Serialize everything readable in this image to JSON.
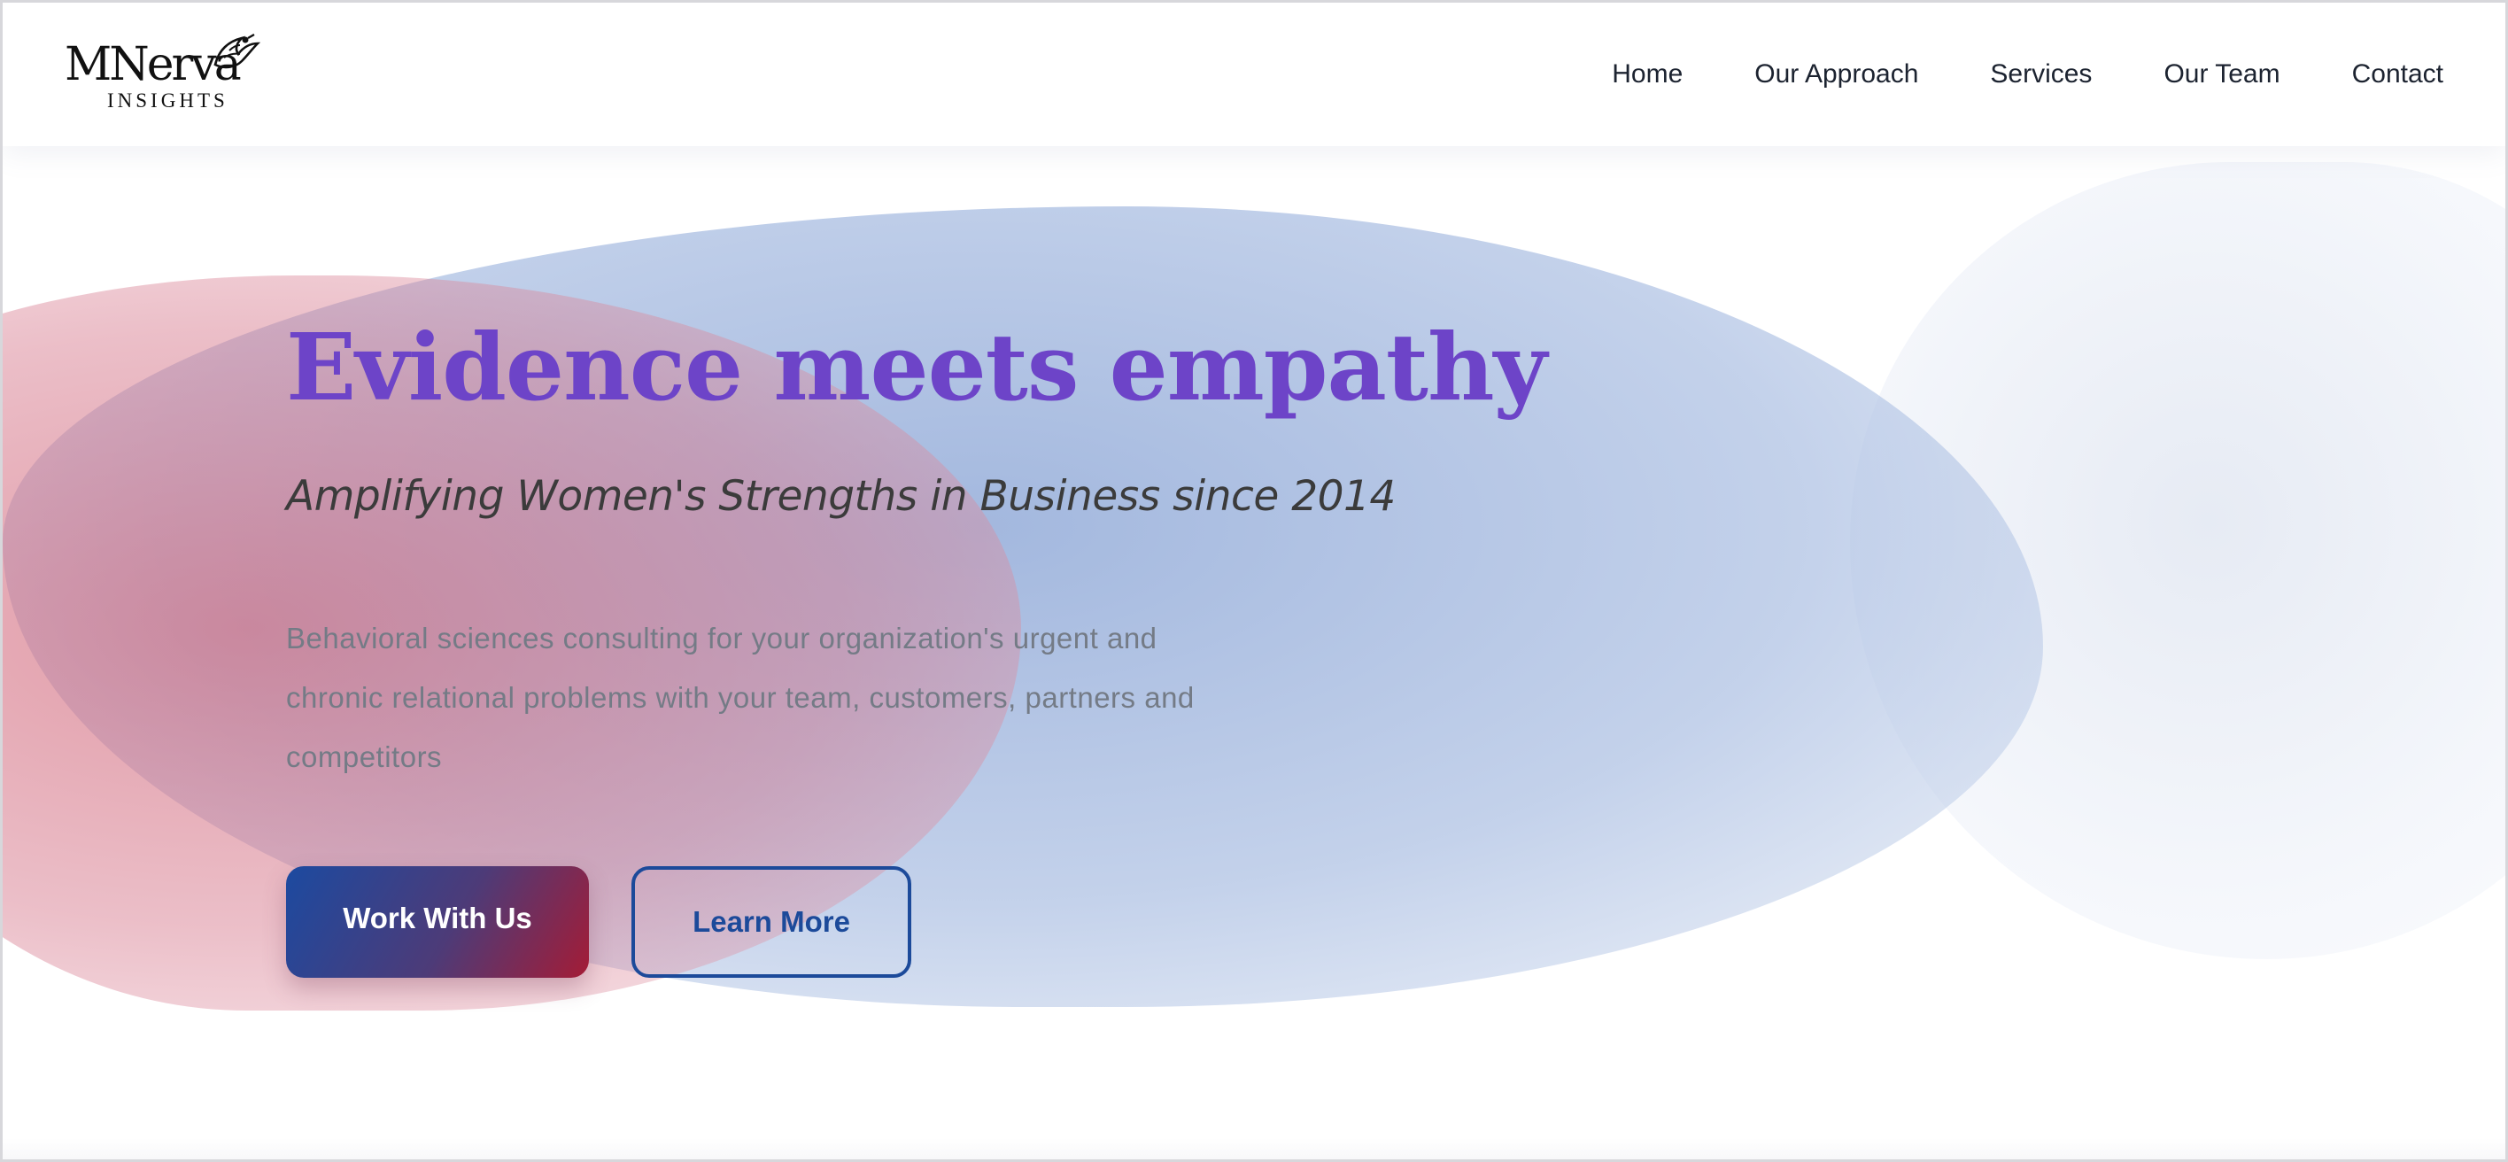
{
  "brand": {
    "name": "MNerva",
    "tagline": "INSIGHTS",
    "logo_icon": "phoenix-bird-icon"
  },
  "nav": {
    "items": [
      {
        "label": "Home"
      },
      {
        "label": "Our Approach"
      },
      {
        "label": "Services"
      },
      {
        "label": "Our Team"
      },
      {
        "label": "Contact"
      }
    ]
  },
  "hero": {
    "headline": "Evidence meets empathy",
    "subheadline": "Amplifying Women's Strengths in Business since 2014",
    "description": "Behavioral sciences consulting for your organization's urgent and chronic relational problems with your team, customers, partners and competitors",
    "primary_button": "Work With Us",
    "secondary_button": "Learn More"
  },
  "colors": {
    "headline": "#6d44c8",
    "primary_button_start": "#1c4aa0",
    "primary_button_end": "#a41c36",
    "secondary_button_border": "#1c4a9a",
    "blob_blue": "#8ca6d6",
    "blob_red": "#ce5c70"
  }
}
